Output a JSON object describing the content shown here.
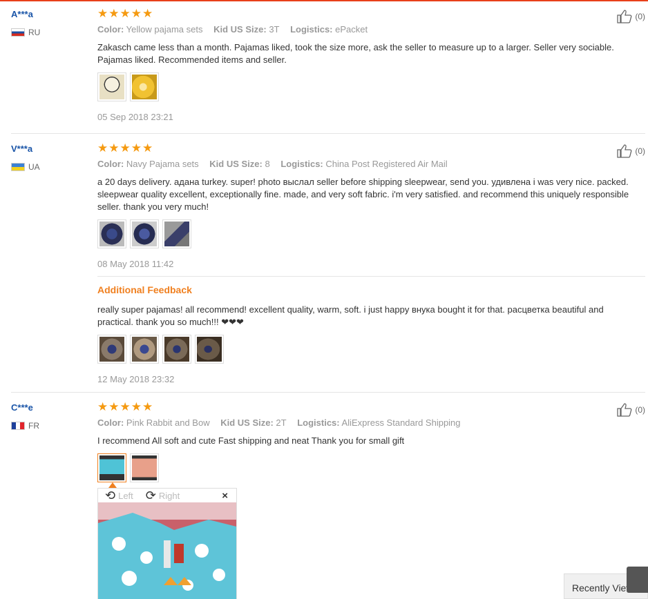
{
  "reviews": [
    {
      "user": "A***a",
      "country": "RU",
      "stars": "★★★★★",
      "color_label": "Color:",
      "color": "Yellow pajama sets",
      "size_label": "Kid US Size:",
      "size": "3T",
      "logistics_label": "Logistics:",
      "logistics": "ePacket",
      "text": "Zakasch came less than a month. Pajamas liked, took the size more, ask the seller to measure up to a larger. Seller very sociable. Pajamas liked. Recommended items and seller.",
      "date": "05 Sep 2018 23:21",
      "likes": "(0)"
    },
    {
      "user": "V***a",
      "country": "UA",
      "stars": "★★★★★",
      "color_label": "Color:",
      "color": "Navy Pajama sets",
      "size_label": "Kid US Size:",
      "size": "8",
      "logistics_label": "Logistics:",
      "logistics": "China Post Registered Air Mail",
      "text": "a 20 days delivery. адана turkey. super! photo выслал seller before shipping sleepwear, send you. удивлена i was very nice. packed. sleepwear quality excellent, exceptionally fine. made, and very soft fabric. i'm very satisfied. and recommend this uniquely responsible seller. thank you very much!",
      "date": "08 May 2018 11:42",
      "likes": "(0)",
      "additional_title": "Additional Feedback",
      "additional_text": "really super pajamas! all recommend! excellent quality, warm, soft. i just happy внука bought it for that. расцветка beautiful and practical. thank you so much!!! ❤❤❤",
      "additional_date": "12 May 2018 23:32"
    },
    {
      "user": "C***e",
      "country": "FR",
      "stars": "★★★★★",
      "color_label": "Color:",
      "color": "Pink Rabbit and Bow",
      "size_label": "Kid US Size:",
      "size": "2T",
      "logistics_label": "Logistics:",
      "logistics": "AliExpress Standard Shipping",
      "text": "I recommend All soft and cute Fast shipping and neat Thank you for small gift",
      "likes": "(0)"
    }
  ],
  "viewer": {
    "rotate_left": "Left",
    "rotate_right": "Right",
    "close": "×"
  },
  "recently_viewed": "Recently Viewed",
  "colors": {
    "accent": "#f08020",
    "star": "#f59a11",
    "user": "#1a55a8",
    "topline": "#e8401a"
  }
}
